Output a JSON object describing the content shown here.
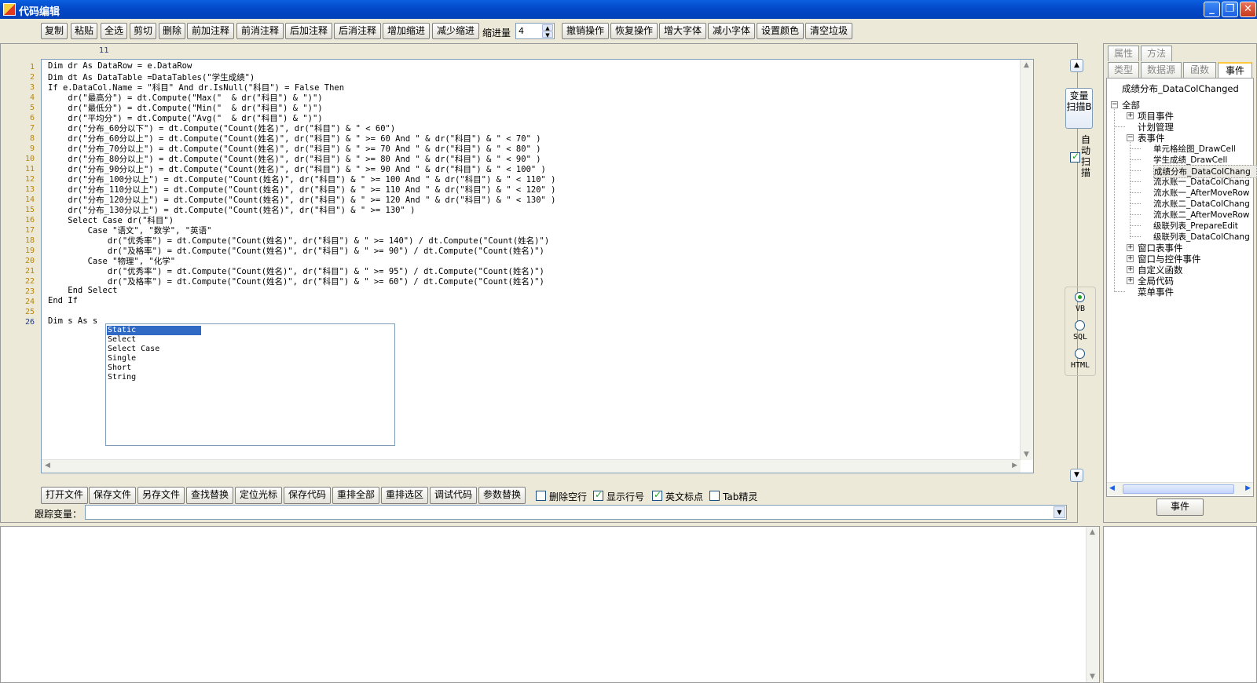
{
  "window": {
    "title": "代码编辑"
  },
  "toolbar": {
    "buttons": [
      "复制",
      "粘贴",
      "全选",
      "剪切",
      "删除",
      "前加注释",
      "前消注释",
      "后加注释",
      "后消注释",
      "增加缩进",
      "减少缩进"
    ],
    "indent_label": "缩进量",
    "indent_value": "4",
    "buttons2": [
      "撤销操作",
      "恢复操作",
      "增大字体",
      "减小字体",
      "设置颜色",
      "清空垃圾"
    ]
  },
  "editor": {
    "column_indicator": "11",
    "line_numbers": [
      "1",
      "2",
      "3",
      "4",
      "5",
      "6",
      "7",
      "8",
      "9",
      "10",
      "11",
      "12",
      "13",
      "14",
      "15",
      "16",
      "17",
      "18",
      "19",
      "20",
      "21",
      "22",
      "23",
      "24",
      "25",
      "26"
    ],
    "lines": [
      "Dim dr As DataRow = e.DataRow",
      "Dim dt As DataTable =DataTables(\"学生成绩\")",
      "If e.DataCol.Name = \"科目\" And dr.IsNull(\"科目\") = False Then",
      "    dr(\"最高分\") = dt.Compute(\"Max(\"  & dr(\"科目\") & \")\")",
      "    dr(\"最低分\") = dt.Compute(\"Min(\"  & dr(\"科目\") & \")\")",
      "    dr(\"平均分\") = dt.Compute(\"Avg(\"  & dr(\"科目\") & \")\")",
      "    dr(\"分布_60分以下\") = dt.Compute(\"Count(姓名)\", dr(\"科目\") & \" < 60\")",
      "    dr(\"分布_60分以上\") = dt.Compute(\"Count(姓名)\", dr(\"科目\") & \" >= 60 And \" & dr(\"科目\") & \" < 70\" )",
      "    dr(\"分布_70分以上\") = dt.Compute(\"Count(姓名)\", dr(\"科目\") & \" >= 70 And \" & dr(\"科目\") & \" < 80\" )",
      "    dr(\"分布_80分以上\") = dt.Compute(\"Count(姓名)\", dr(\"科目\") & \" >= 80 And \" & dr(\"科目\") & \" < 90\" )",
      "    dr(\"分布_90分以上\") = dt.Compute(\"Count(姓名)\", dr(\"科目\") & \" >= 90 And \" & dr(\"科目\") & \" < 100\" )",
      "    dr(\"分布_100分以上\") = dt.Compute(\"Count(姓名)\", dr(\"科目\") & \" >= 100 And \" & dr(\"科目\") & \" < 110\" )",
      "    dr(\"分布_110分以上\") = dt.Compute(\"Count(姓名)\", dr(\"科目\") & \" >= 110 And \" & dr(\"科目\") & \" < 120\" )",
      "    dr(\"分布_120分以上\") = dt.Compute(\"Count(姓名)\", dr(\"科目\") & \" >= 120 And \" & dr(\"科目\") & \" < 130\" )",
      "    dr(\"分布_130分以上\") = dt.Compute(\"Count(姓名)\", dr(\"科目\") & \" >= 130\" )",
      "    Select Case dr(\"科目\")",
      "        Case \"语文\", \"数学\", \"英语\"",
      "            dr(\"优秀率\") = dt.Compute(\"Count(姓名)\", dr(\"科目\") & \" >= 140\") / dt.Compute(\"Count(姓名)\")",
      "            dr(\"及格率\") = dt.Compute(\"Count(姓名)\", dr(\"科目\") & \" >= 90\") / dt.Compute(\"Count(姓名)\")",
      "        Case \"物理\", \"化学\"",
      "            dr(\"优秀率\") = dt.Compute(\"Count(姓名)\", dr(\"科目\") & \" >= 95\") / dt.Compute(\"Count(姓名)\")",
      "            dr(\"及格率\") = dt.Compute(\"Count(姓名)\", dr(\"科目\") & \" >= 60\") / dt.Compute(\"Count(姓名)\")",
      "    End Select",
      "End If",
      "",
      "Dim s As s"
    ],
    "autocomplete": [
      "Static",
      "Select",
      "Select Case",
      "Single",
      "Short",
      "String"
    ],
    "autocomplete_selected": 0
  },
  "side_controls": {
    "scan_button": "变量扫描B",
    "auto_scan_label": "自动扫描",
    "auto_scan_checked": true,
    "languages": [
      "VB",
      "SQL",
      "HTML"
    ],
    "language_selected": "VB"
  },
  "bottom_bar": {
    "buttons": [
      "打开文件",
      "保存文件",
      "另存文件",
      "查找替换",
      "定位光标",
      "保存代码",
      "重排全部",
      "重排选区",
      "调试代码",
      "参数替换"
    ],
    "checkboxes": [
      {
        "label": "删除空行",
        "checked": false
      },
      {
        "label": "显示行号",
        "checked": true
      },
      {
        "label": "英文标点",
        "checked": true
      },
      {
        "label": "Tab精灵",
        "checked": false
      }
    ],
    "trace_label": "跟踪变量："
  },
  "right_panel": {
    "tabs_row1": [
      "属性",
      "方法"
    ],
    "tabs_row2": [
      "类型",
      "数据源",
      "函数",
      "事件"
    ],
    "active_tab": "事件",
    "current_event": "成绩分布_DataColChanged",
    "tree": [
      {
        "label": "全部",
        "level": 0,
        "expander": "-"
      },
      {
        "label": "项目事件",
        "level": 1,
        "expander": "+"
      },
      {
        "label": "计划管理",
        "level": 1,
        "expander": ""
      },
      {
        "label": "表事件",
        "level": 1,
        "expander": "-"
      },
      {
        "label": "单元格绘图_DrawCell",
        "level": 2,
        "expander": ""
      },
      {
        "label": "学生成绩_DrawCell",
        "level": 2,
        "expander": ""
      },
      {
        "label": "成绩分布_DataColChang",
        "level": 2,
        "expander": "",
        "selected": true
      },
      {
        "label": "流水账一_DataColChang",
        "level": 2,
        "expander": ""
      },
      {
        "label": "流水账一_AfterMoveRow",
        "level": 2,
        "expander": ""
      },
      {
        "label": "流水账二_DataColChang",
        "level": 2,
        "expander": ""
      },
      {
        "label": "流水账二_AfterMoveRow",
        "level": 2,
        "expander": ""
      },
      {
        "label": "级联列表_PrepareEdit",
        "level": 2,
        "expander": ""
      },
      {
        "label": "级联列表_DataColChang",
        "level": 2,
        "expander": ""
      },
      {
        "label": "窗口表事件",
        "level": 1,
        "expander": "+"
      },
      {
        "label": "窗口与控件事件",
        "level": 1,
        "expander": "+"
      },
      {
        "label": "自定义函数",
        "level": 1,
        "expander": "+"
      },
      {
        "label": "全局代码",
        "level": 1,
        "expander": "+"
      },
      {
        "label": "菜单事件",
        "level": 1,
        "expander": ""
      }
    ],
    "event_button": "事件"
  }
}
